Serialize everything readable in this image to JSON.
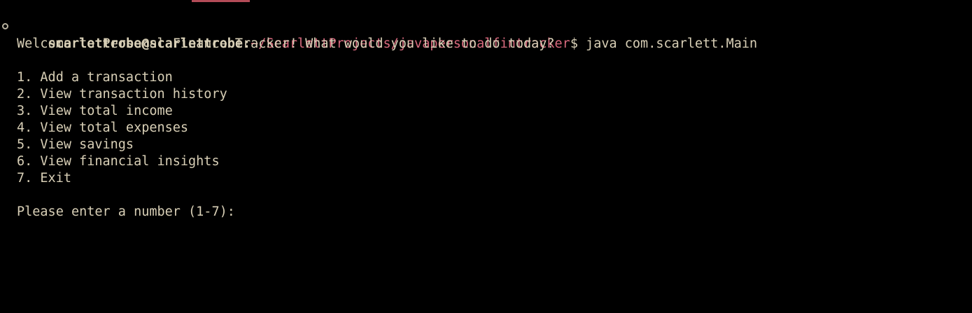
{
  "terminal": {
    "prompt": {
      "user_host": "scarlettrobe@scarlettrobe",
      "separator": ":",
      "path": "~/ScarlettProjects/javapersonalfintracker",
      "symbol": "$",
      "command": " java com.scarlett.Main"
    },
    "welcome": "Welcome to Personal Finance Tracker! What would you like to do today?",
    "menu": [
      "1. Add a transaction",
      "2. View transaction history",
      "3. View total income",
      "4. View total expenses",
      "5. View savings",
      "6. View financial insights",
      "7. Exit"
    ],
    "input_prompt": "Please enter a number (1-7):"
  },
  "colors": {
    "background": "#000000",
    "text": "#d8cfb6",
    "path": "#d86a7e",
    "tab_accent": "#b34b57"
  }
}
